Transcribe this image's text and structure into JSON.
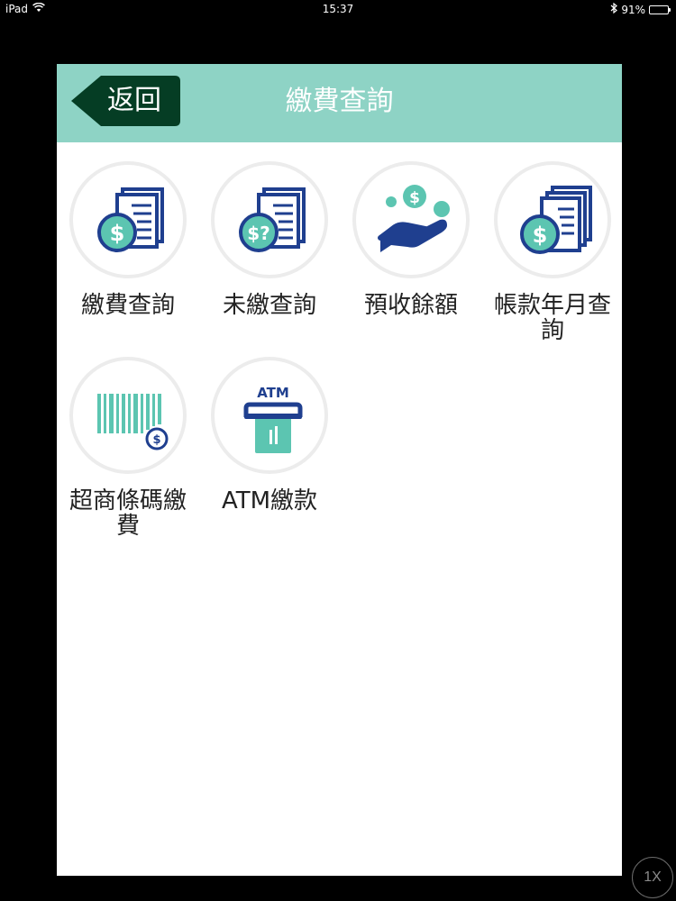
{
  "status_bar": {
    "device": "iPad",
    "time": "15:37",
    "battery": "91%"
  },
  "header": {
    "back_label": "返回",
    "title": "繳費查詢"
  },
  "menu": [
    {
      "label": "繳費查詢",
      "icon": "bill-dollar-icon"
    },
    {
      "label": "未繳查詢",
      "icon": "bill-question-icon"
    },
    {
      "label": "預收餘額",
      "icon": "hand-coins-icon"
    },
    {
      "label": "帳款年月查詢",
      "icon": "bills-dollar-icon"
    },
    {
      "label": "超商條碼繳費",
      "icon": "barcode-dollar-icon"
    },
    {
      "label": "ATM繳款",
      "icon": "atm-icon"
    }
  ],
  "atm_text": "ATM",
  "colors": {
    "header_bg": "#8ed3c5",
    "back_button_bg": "#053d24",
    "icon_navy": "#1f3f8f",
    "icon_teal": "#5cc5b1"
  }
}
